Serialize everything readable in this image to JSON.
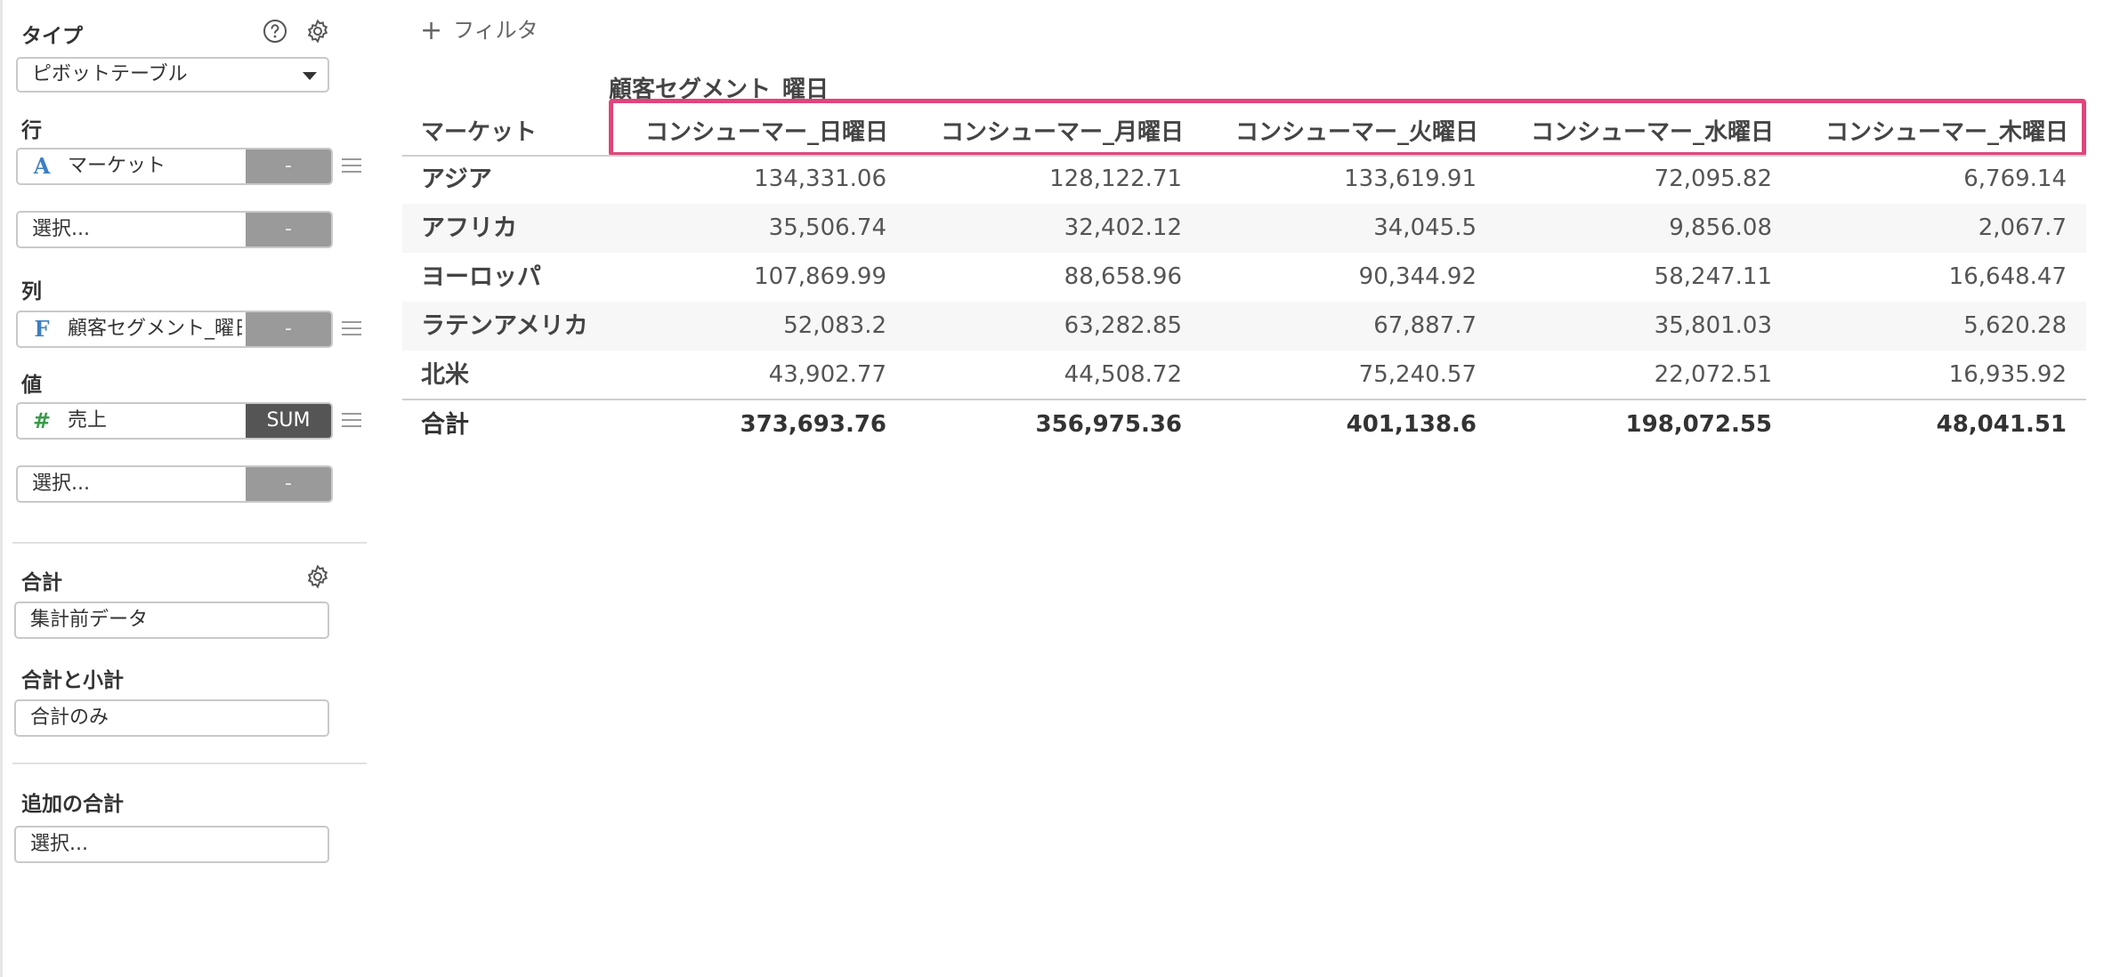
{
  "sidebar": {
    "type_label": "タイプ",
    "type_value": "ピボットテーブル",
    "rows_label": "行",
    "rows_field": {
      "type_icon": "A",
      "name": "マーケット",
      "agg": "-"
    },
    "rows_select": {
      "placeholder": "選択...",
      "agg": "-"
    },
    "cols_label": "列",
    "cols_field": {
      "type_icon": "F",
      "name": "顧客セグメント_曜日",
      "agg": "-"
    },
    "values_label": "値",
    "values_field": {
      "type_icon": "#",
      "name": "売上",
      "agg": "SUM"
    },
    "values_select": {
      "placeholder": "選択...",
      "agg": "-"
    },
    "total_label": "合計",
    "total_value": "集計前データ",
    "subtotal_label": "合計と小計",
    "subtotal_value": "合計のみ",
    "extra_total_label": "追加の合計",
    "extra_total_placeholder": "選択..."
  },
  "icons": {
    "help": "help-circle-icon",
    "settings": "gear-icon",
    "drag": "drag-handle-icon",
    "add": "plus-icon"
  },
  "colors": {
    "highlight": "#e0457b",
    "string_type": "#3b7fc4",
    "date_type": "#3b7fc4",
    "number_type": "#3a9a4a"
  },
  "filter": {
    "label": "フィルタ"
  },
  "table": {
    "column_group_title": "顧客セグメント_曜日",
    "row_header_title": "マーケット",
    "columns": [
      "コンシューマー_日曜日",
      "コンシューマー_月曜日",
      "コンシューマー_火曜日",
      "コンシューマー_水曜日",
      "コンシューマー_木曜日"
    ],
    "rows": [
      {
        "label": "アジア",
        "values": [
          "134,331.06",
          "128,122.71",
          "133,619.91",
          "72,095.82",
          "6,769.14"
        ]
      },
      {
        "label": "アフリカ",
        "values": [
          "35,506.74",
          "32,402.12",
          "34,045.5",
          "9,856.08",
          "2,067.7"
        ]
      },
      {
        "label": "ヨーロッパ",
        "values": [
          "107,869.99",
          "88,658.96",
          "90,344.92",
          "58,247.11",
          "16,648.47"
        ]
      },
      {
        "label": "ラテンアメリカ",
        "values": [
          "52,083.2",
          "63,282.85",
          "67,887.7",
          "35,801.03",
          "5,620.28"
        ]
      },
      {
        "label": "北米",
        "values": [
          "43,902.77",
          "44,508.72",
          "75,240.57",
          "22,072.51",
          "16,935.92"
        ]
      }
    ],
    "total": {
      "label": "合計",
      "values": [
        "373,693.76",
        "356,975.36",
        "401,138.6",
        "198,072.55",
        "48,041.51"
      ]
    }
  }
}
